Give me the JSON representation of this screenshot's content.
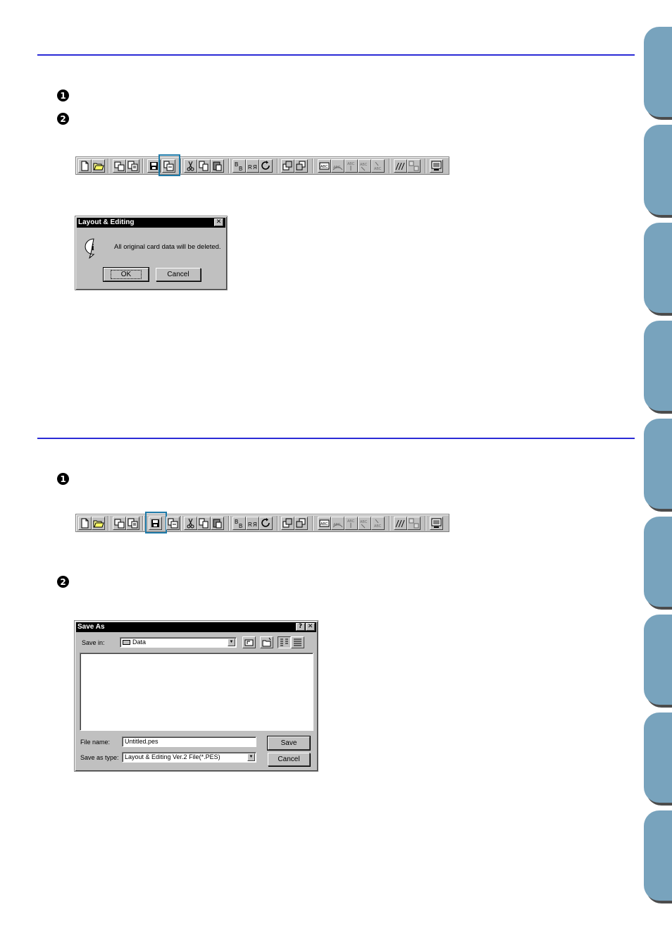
{
  "section1": {
    "steps": [
      "1",
      "2"
    ]
  },
  "section2": {
    "steps": [
      "1",
      "2"
    ]
  },
  "dialog1": {
    "title": "Layout & Editing",
    "close_glyph": "✕",
    "info_glyph": "i",
    "message": "All original card data will be deleted.",
    "ok_label": "OK",
    "cancel_label": "Cancel"
  },
  "dialog2": {
    "title": "Save As",
    "help_glyph": "?",
    "close_glyph": "✕",
    "save_in_label": "Save in:",
    "save_in_value": "Data",
    "file_name_label": "File name:",
    "file_name_value": "Untitled.pes",
    "save_as_type_label": "Save as type:",
    "save_as_type_value": "Layout & Editing Ver.2 File(*.PES)",
    "save_label": "Save",
    "cancel_label": "Cancel"
  },
  "toolbar1": {
    "highlighted": "send-to-card-button"
  },
  "toolbar2": {
    "highlighted": "save-button"
  },
  "colors": {
    "rule": "#2b2bd6",
    "tab": "#78a3bd",
    "highlight": "#1e7aa8"
  }
}
